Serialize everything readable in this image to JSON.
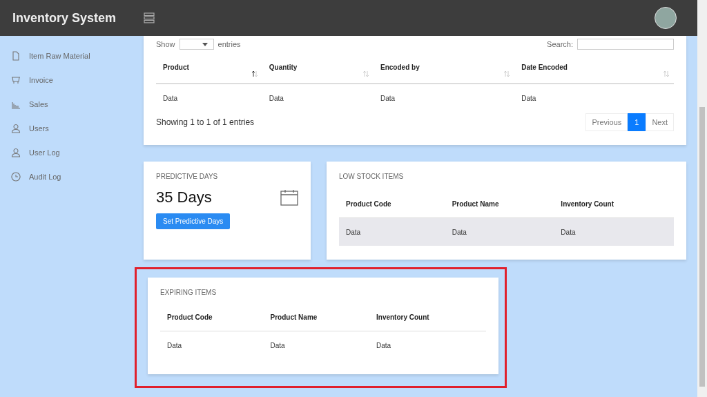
{
  "header": {
    "title": "Inventory System"
  },
  "sidebar": {
    "items": [
      {
        "label": "Item Raw Material"
      },
      {
        "label": "Invoice"
      },
      {
        "label": "Sales"
      },
      {
        "label": "Users"
      },
      {
        "label": "User Log"
      },
      {
        "label": "Audit Log"
      }
    ]
  },
  "entries_table": {
    "show_label": "Show",
    "entries_label": "entries",
    "search_label": "Search:",
    "columns": [
      {
        "label": "Product",
        "sorted": true
      },
      {
        "label": "Quantity",
        "sorted": false
      },
      {
        "label": "Encoded by",
        "sorted": false
      },
      {
        "label": "Date Encoded",
        "sorted": false
      }
    ],
    "rows": [
      [
        "Data",
        "Data",
        "Data",
        "Data"
      ]
    ],
    "info": "Showing 1 to 1 of 1 entries",
    "pagination": [
      {
        "label": "Previous",
        "selected": false
      },
      {
        "label": "1",
        "selected": true
      },
      {
        "label": "Next",
        "selected": false
      }
    ]
  },
  "predictive_days": {
    "title": "PREDICTIVE DAYS",
    "value": "35 Days",
    "button": "Set Predictive Days"
  },
  "low_stock": {
    "title": "LOW STOCK ITEMS",
    "columns": [
      "Product Code",
      "Product Name",
      "Inventory Count"
    ],
    "rows": [
      {
        "cells": [
          "Data",
          "Data",
          "Data"
        ],
        "highlighted": true
      }
    ]
  },
  "expiring": {
    "title": "EXPIRING ITEMS",
    "annotated": true,
    "columns": [
      "Product Code",
      "Product Name",
      "Inventory Count"
    ],
    "rows": [
      {
        "cells": [
          "Data",
          "Data",
          "Data"
        ],
        "highlighted": false
      }
    ]
  }
}
